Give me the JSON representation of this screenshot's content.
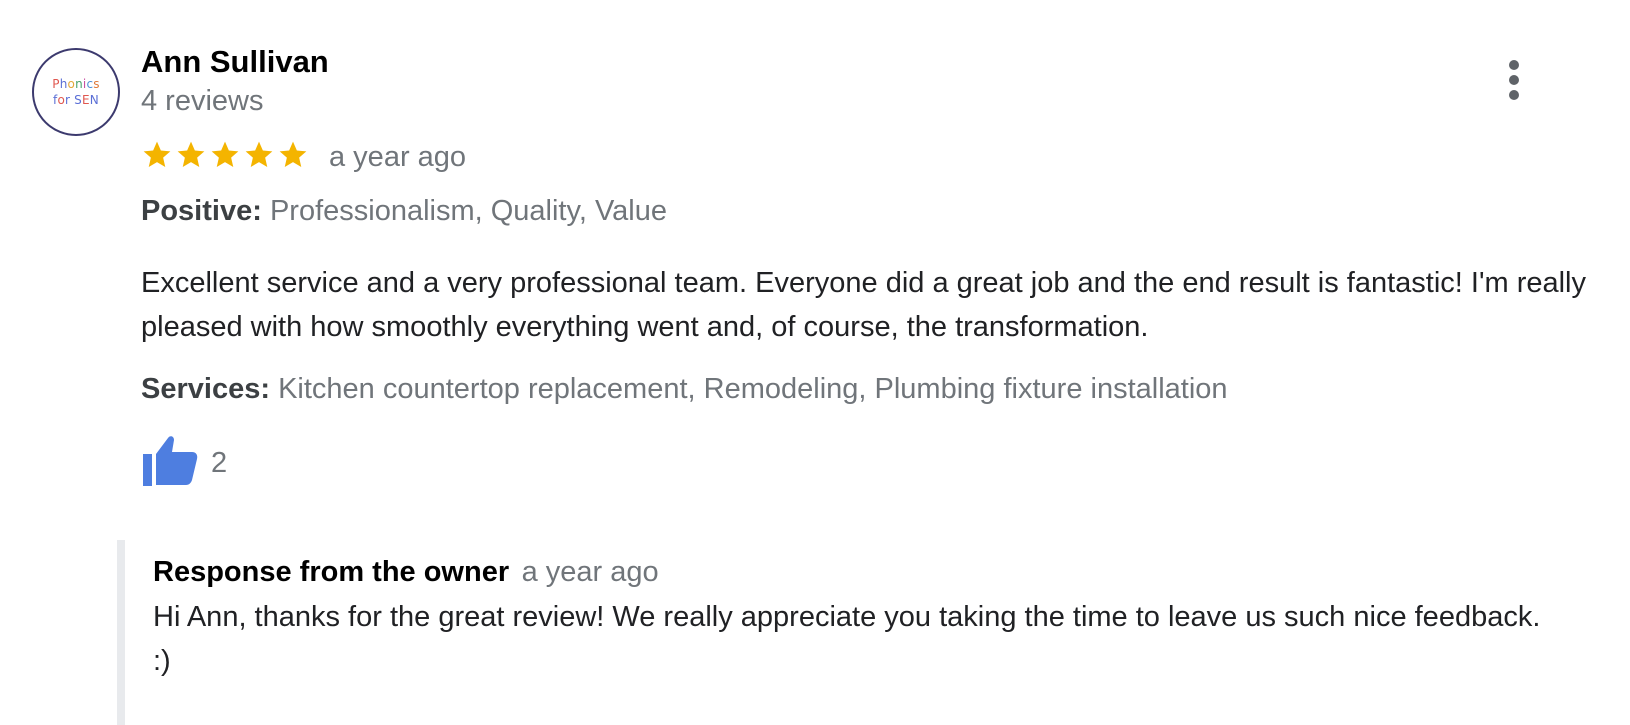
{
  "review": {
    "author": {
      "name": "Ann Sullivan",
      "review_count": "4 reviews",
      "avatar_line1": "Phonics",
      "avatar_line2": "for SEN"
    },
    "rating": 5,
    "rating_max": 5,
    "time": "a year ago",
    "positive": {
      "label": "Positive:",
      "value": "Professionalism, Quality, Value"
    },
    "text": "Excellent service and a very professional team. Everyone did a great job and the end result is fantastic! I'm really pleased with how smoothly everything went and, of course, the transformation.",
    "services": {
      "label": "Services:",
      "value": "Kitchen countertop replacement, Remodeling, Plumbing fixture installation"
    },
    "likes": "2",
    "owner_response": {
      "title": "Response from the owner",
      "time": "a year ago",
      "text": "Hi Ann, thanks for the great review! We really appreciate you taking the time to leave us such nice feedback. :)"
    }
  },
  "icons": {
    "star": "star-icon",
    "like": "thumbs-up-icon",
    "more": "more-vertical-icon"
  },
  "colors": {
    "star": "#f4b400",
    "like": "#4e7ee0",
    "muted_text": "#70757a",
    "response_bar": "#e8eaed"
  }
}
